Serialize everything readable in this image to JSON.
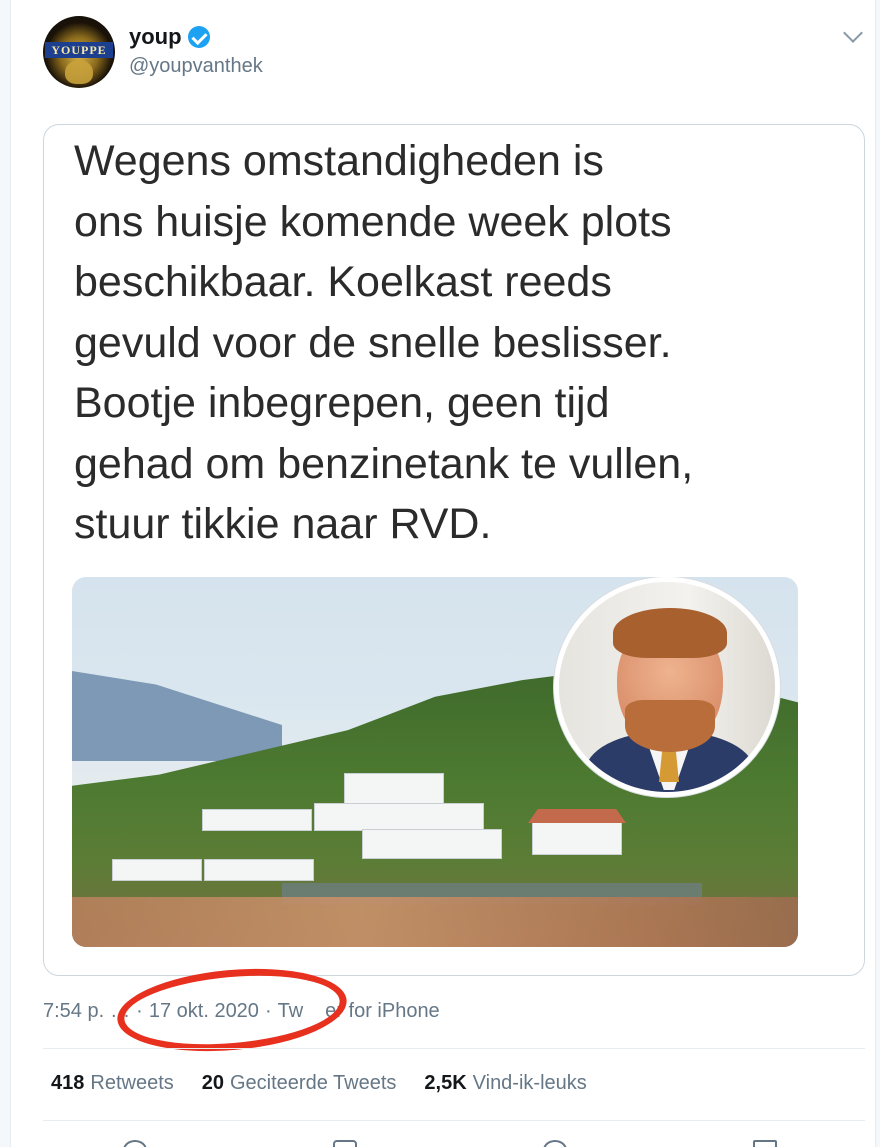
{
  "tweet": {
    "display_name": "youp",
    "handle": "@youpvanthek",
    "avatar_logo_text": "YOUPPE",
    "quote_lines": [
      "Wegens omstandigheden is",
      "ons huisje komende week plots",
      "beschikbaar. Koelkast reeds",
      "gevuld voor de snelle beslisser.",
      "Bootje inbegrepen, geen tijd",
      "gehad om benzinetank te vullen,",
      "stuur tikkie naar RVD."
    ],
    "time": "7:54 p.",
    "time_hidden": "…",
    "separator": "·",
    "date": "17 okt. 2020",
    "source_partial_1": "Tw",
    "source_partial_2": "er for iPhone"
  },
  "stats": {
    "retweets_count": "418",
    "retweets_label": "Retweets",
    "quotes_count": "20",
    "quotes_label": "Geciteerde Tweets",
    "likes_count": "2,5K",
    "likes_label": "Vind-ik-leuks"
  },
  "colors": {
    "verified": "#1da1f2",
    "annotation_circle": "#e8301f",
    "secondary_text": "#657786"
  },
  "icons": [
    "verified-badge-icon",
    "chevron-down-icon",
    "reply-icon",
    "retweet-icon",
    "like-icon",
    "share-icon"
  ]
}
